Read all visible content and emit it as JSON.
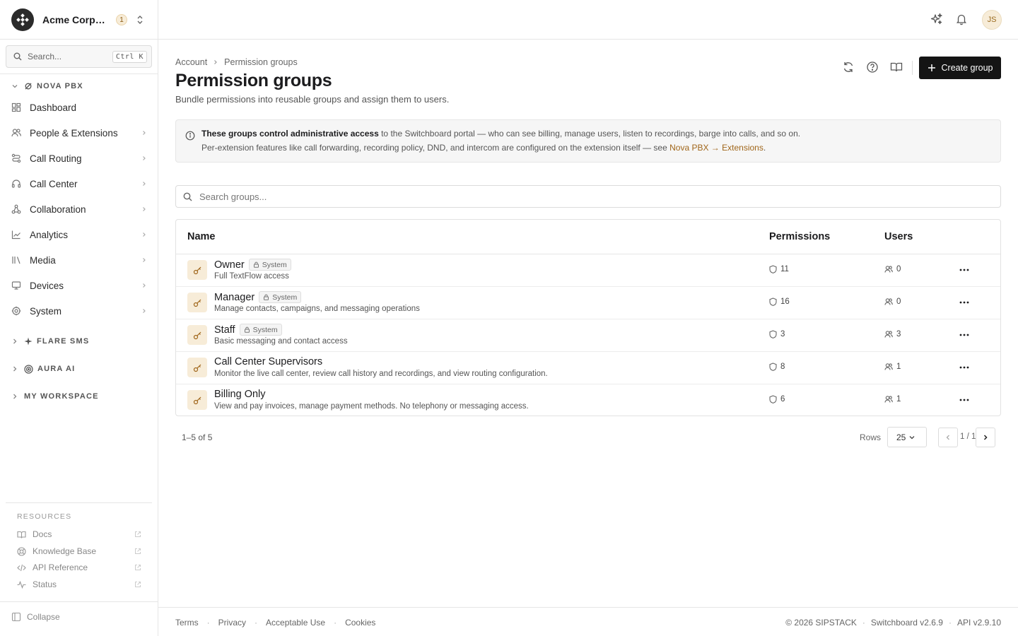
{
  "org": {
    "name": "Acme Corporation",
    "badge": "1"
  },
  "sidebar": {
    "search_placeholder": "Search...",
    "search_shortcut": "Ctrl K",
    "sections": [
      {
        "label": "NOVA PBX",
        "expanded": true
      },
      {
        "label": "FLARE SMS",
        "expanded": false
      },
      {
        "label": "AURA AI",
        "expanded": false
      },
      {
        "label": "MY WORKSPACE",
        "expanded": false
      }
    ],
    "nav": [
      {
        "label": "Dashboard",
        "icon": "dashboard-icon"
      },
      {
        "label": "People & Extensions",
        "icon": "people-icon"
      },
      {
        "label": "Call Routing",
        "icon": "routing-icon"
      },
      {
        "label": "Call Center",
        "icon": "headset-icon"
      },
      {
        "label": "Collaboration",
        "icon": "collaboration-icon"
      },
      {
        "label": "Analytics",
        "icon": "analytics-icon"
      },
      {
        "label": "Media",
        "icon": "media-icon"
      },
      {
        "label": "Devices",
        "icon": "devices-icon"
      },
      {
        "label": "System",
        "icon": "system-icon"
      }
    ],
    "resources_label": "RESOURCES",
    "resources": [
      {
        "label": "Docs",
        "icon": "book-icon"
      },
      {
        "label": "Knowledge Base",
        "icon": "lifebuoy-icon"
      },
      {
        "label": "API Reference",
        "icon": "code-icon"
      },
      {
        "label": "Status",
        "icon": "pulse-icon"
      }
    ],
    "collapse_label": "Collapse"
  },
  "topbar": {
    "avatar_initials": "JS"
  },
  "page": {
    "breadcrumb": [
      "Account",
      "Permission groups"
    ],
    "title": "Permission groups",
    "subtitle": "Bundle permissions into reusable groups and assign them to users.",
    "create_label": "Create group"
  },
  "notice": {
    "bold": "These groups control administrative access",
    "line1_rest": " to the Switchboard portal — who can see billing, manage users, listen to recordings, barge into calls, and so on.",
    "line2_prefix": "Per-extension features like call forwarding, recording policy, DND, and intercom are configured on the extension itself — see ",
    "line2_link": "Nova PBX → Extensions",
    "line2_suffix": "."
  },
  "group_search_placeholder": "Search groups...",
  "table": {
    "columns": [
      "Name",
      "Permissions",
      "Users"
    ],
    "system_label": "System",
    "rows": [
      {
        "name": "Owner",
        "system": true,
        "description": "Full TextFlow access",
        "permissions": "11",
        "users": "0"
      },
      {
        "name": "Manager",
        "system": true,
        "description": "Manage contacts, campaigns, and messaging operations",
        "permissions": "16",
        "users": "0"
      },
      {
        "name": "Staff",
        "system": true,
        "description": "Basic messaging and contact access",
        "permissions": "3",
        "users": "3"
      },
      {
        "name": "Call Center Supervisors",
        "system": false,
        "description": "Monitor the live call center, review call history and recordings, and view routing configuration.",
        "permissions": "8",
        "users": "1"
      },
      {
        "name": "Billing Only",
        "system": false,
        "description": "View and pay invoices, manage payment methods. No telephony or messaging access.",
        "permissions": "6",
        "users": "1"
      }
    ]
  },
  "pagination": {
    "range": "1–5 of 5",
    "rows_label": "Rows",
    "rows_value": "25",
    "page_info": "1 / 1"
  },
  "footer": {
    "links": [
      "Terms",
      "Privacy",
      "Acceptable Use",
      "Cookies"
    ],
    "copyright": "© 2026 SIPSTACK",
    "version": "Switchboard v2.6.9",
    "api": "API v2.9.10"
  }
}
